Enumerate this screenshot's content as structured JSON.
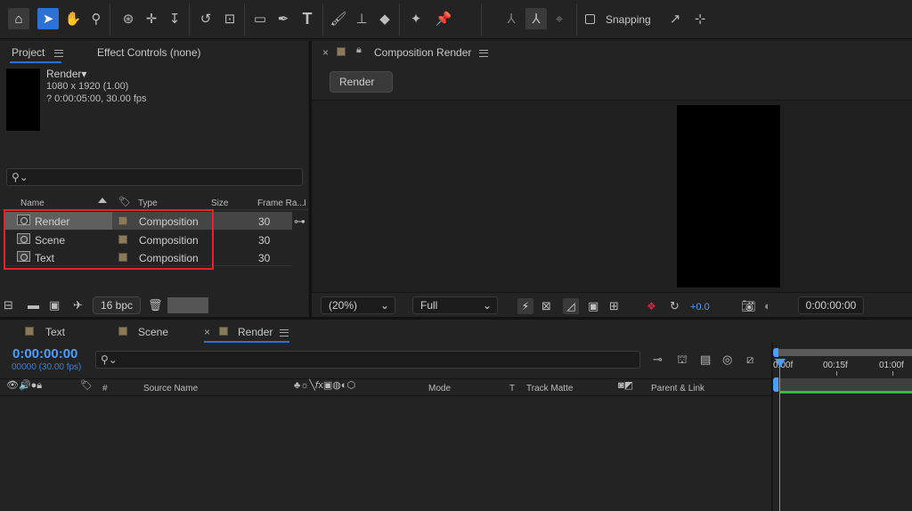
{
  "toolbar": {
    "snapping_label": "Snapping",
    "tools": [
      "home-icon",
      "selection-tool-icon",
      "hand-tool-icon",
      "zoom-tool-icon",
      "orbit-camera-icon",
      "pan-camera-icon",
      "dolly-camera-icon",
      "rotate-tool-icon",
      "pan-behind-icon",
      "rectangle-tool-icon",
      "pen-tool-icon",
      "type-tool-icon",
      "brush-tool-icon",
      "clone-stamp-icon",
      "eraser-tool-icon",
      "roto-brush-icon",
      "puppet-pin-icon"
    ]
  },
  "project_panel": {
    "tab_project": "Project",
    "tab_effect_controls": "Effect Controls (none)",
    "comp_name": "Render▾",
    "comp_dims": "1080 x 1920 (1.00)",
    "comp_duration": "? 0:00:05:00, 30.00 fps",
    "columns": {
      "name": "Name",
      "type": "Type",
      "size": "Size",
      "frame_rate": "Frame Ra...",
      "extra": "I"
    },
    "items": [
      {
        "name": "Render",
        "type": "Composition",
        "frame_rate": "30"
      },
      {
        "name": "Scene",
        "type": "Composition",
        "frame_rate": "30"
      },
      {
        "name": "Text",
        "type": "Composition",
        "frame_rate": "30"
      }
    ],
    "bpc": "16 bpc"
  },
  "composition_panel": {
    "title": "Composition Render",
    "render_button": "Render",
    "zoom": "(20%)",
    "resolution": "Full",
    "exposure": "+0.0",
    "timecode": "0:00:00:00"
  },
  "timeline": {
    "tabs": [
      "Text",
      "Scene",
      "Render"
    ],
    "active_tab": "Render",
    "timecode": "0:00:00:00",
    "frames": "00000 (30.00 fps)",
    "headers": {
      "num": "#",
      "source_name": "Source Name",
      "mode": "Mode",
      "t": "T",
      "track_matte": "Track Matte",
      "parent": "Parent & Link"
    },
    "ruler": [
      "0:00f",
      "00:15f",
      "01:00f"
    ]
  },
  "colors": {
    "accent_blue": "#2d71d6",
    "timecode_blue": "#4a9eff",
    "highlight_red": "#e0262b",
    "work_area_green": "#2fbf3a",
    "label_tan": "#8a7a5a"
  }
}
